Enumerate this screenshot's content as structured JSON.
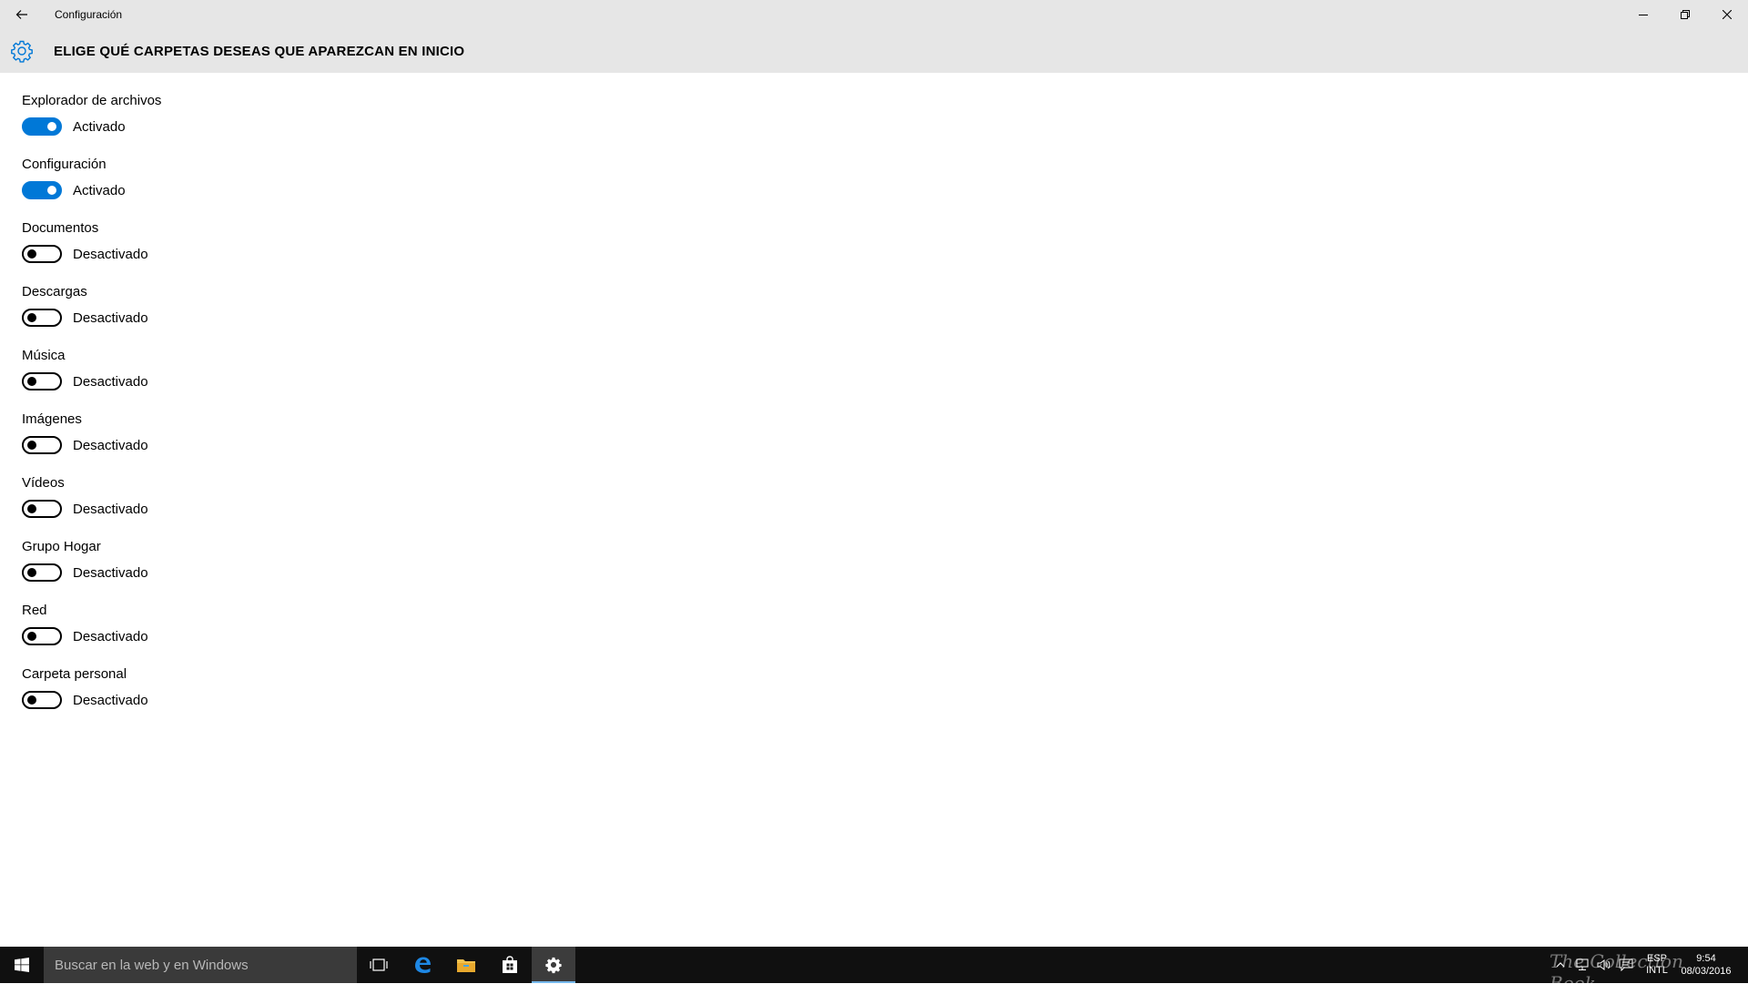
{
  "window": {
    "title": "Configuración"
  },
  "header": {
    "title": "ELIGE QUÉ CARPETAS DESEAS QUE APAREZCAN EN INICIO"
  },
  "settings": [
    {
      "label": "Explorador de archivos",
      "state": "Activado",
      "on": true
    },
    {
      "label": "Configuración",
      "state": "Activado",
      "on": true
    },
    {
      "label": "Documentos",
      "state": "Desactivado",
      "on": false
    },
    {
      "label": "Descargas",
      "state": "Desactivado",
      "on": false
    },
    {
      "label": "Música",
      "state": "Desactivado",
      "on": false
    },
    {
      "label": "Imágenes",
      "state": "Desactivado",
      "on": false
    },
    {
      "label": "Vídeos",
      "state": "Desactivado",
      "on": false
    },
    {
      "label": "Grupo Hogar",
      "state": "Desactivado",
      "on": false
    },
    {
      "label": "Red",
      "state": "Desactivado",
      "on": false
    },
    {
      "label": "Carpeta personal",
      "state": "Desactivado",
      "on": false
    }
  ],
  "taskbar": {
    "search_placeholder": "Buscar en la web y en Windows",
    "watermark": "The Collection Book",
    "lang_line1": "ESP",
    "lang_line2": "INTL",
    "time": "9:54",
    "date": "08/03/2016"
  },
  "colors": {
    "accent": "#0078d7",
    "titlebar": "#e6e6e6",
    "taskbar": "#101010"
  }
}
